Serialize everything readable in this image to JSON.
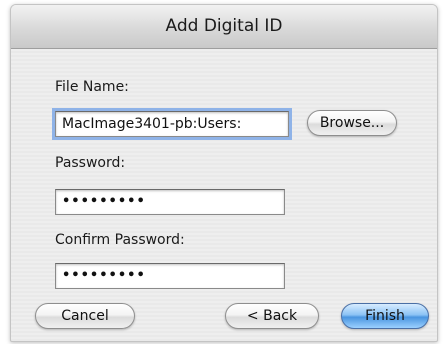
{
  "dialog": {
    "title": "Add Digital ID"
  },
  "form": {
    "file_name_label": "File Name:",
    "file_name_value": "MacImage3401-pb:Users:",
    "browse_label": "Browse...",
    "password_label": "Password:",
    "password_value": "•••••••••",
    "confirm_password_label": "Confirm Password:",
    "confirm_password_value": "•••••••••"
  },
  "footer": {
    "cancel_label": "Cancel",
    "back_label": "< Back",
    "finish_label": "Finish"
  },
  "colors": {
    "default_button": "#4a95e0",
    "focus_ring": "#8fb3e8"
  }
}
